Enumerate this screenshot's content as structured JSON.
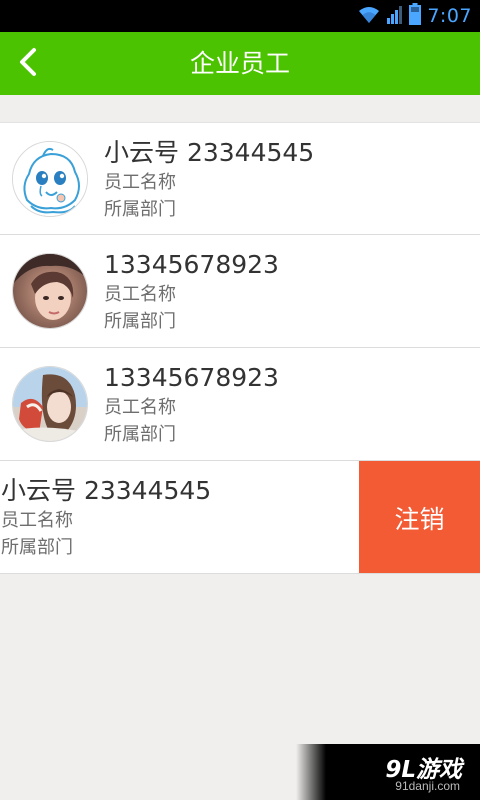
{
  "status_bar": {
    "time": "7:07",
    "icons": [
      "wifi-icon",
      "signal-icon",
      "battery-icon"
    ],
    "time_color": "#4aa6ff"
  },
  "header": {
    "title": "企业员工",
    "back_icon": "chevron-left-icon",
    "background": "#4cc300"
  },
  "employees": [
    {
      "name": "小云号 23344545",
      "role": "员工名称",
      "department": "所属部门",
      "avatar": "cartoon-avatar"
    },
    {
      "name": "13345678923",
      "role": "员工名称",
      "department": "所属部门",
      "avatar": "photo-avatar"
    },
    {
      "name": "13345678923",
      "role": "员工名称",
      "department": "所属部门",
      "avatar": "photo-avatar"
    },
    {
      "name": "小云号 23344545",
      "role": "员工名称",
      "department": "所属部门",
      "swiped": true
    }
  ],
  "row_action": {
    "label": "注销",
    "color": "#f35b35"
  },
  "watermark": {
    "logo": "9L游戏",
    "site": "91danji.com"
  }
}
